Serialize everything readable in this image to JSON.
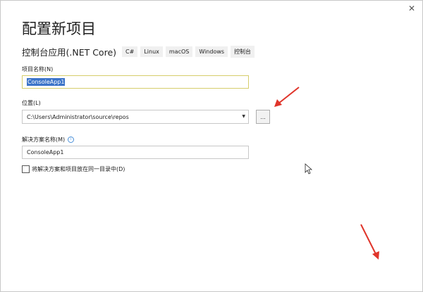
{
  "window": {
    "close_glyph": "✕"
  },
  "header": {
    "title": "配置新项目",
    "subtitle": "控制台应用(.NET Core)",
    "tags": [
      "C#",
      "Linux",
      "macOS",
      "Windows",
      "控制台"
    ]
  },
  "project_name": {
    "label": "项目名称(N)",
    "value": "ConsoleApp1"
  },
  "location": {
    "label": "位置(L)",
    "value": "C:\\Users\\Administrator\\source\\repos",
    "browse_label": "..."
  },
  "solution_name": {
    "label": "解决方案名称(M)",
    "value": "ConsoleApp1"
  },
  "same_directory": {
    "label": "将解决方案和项目放在同一目录中(D)",
    "checked": false
  },
  "icons": {
    "info": "info-icon",
    "dropdown": "chevron-down-icon",
    "annotation": "red-arrow-icon",
    "cursor": "mouse-cursor-icon"
  },
  "colors": {
    "selection": "#3c74c9",
    "focus_border": "#d6cd6b",
    "annotation_arrow": "#e0352b"
  }
}
